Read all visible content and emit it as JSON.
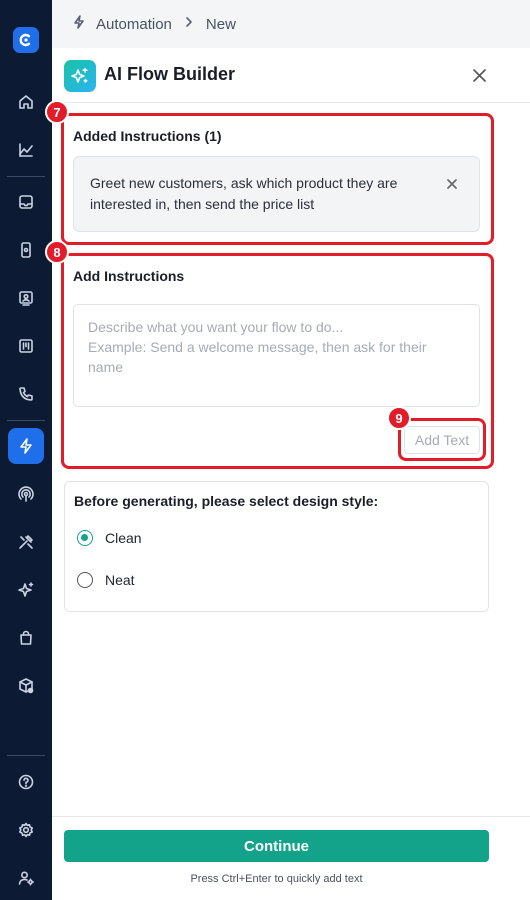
{
  "sidebar": {
    "logo_icon": "brand-logo-icon",
    "items": [
      {
        "icon": "home-icon",
        "label": "Home"
      },
      {
        "icon": "analytics-icon",
        "label": "Analytics"
      },
      {
        "icon": "inbox-icon",
        "label": "Inbox"
      },
      {
        "icon": "mobile-icon",
        "label": "Devices"
      },
      {
        "icon": "contacts-icon",
        "label": "Contacts"
      },
      {
        "icon": "board-icon",
        "label": "Board"
      },
      {
        "icon": "phone-icon",
        "label": "Calls"
      },
      {
        "icon": "automation-icon",
        "label": "Automation",
        "active": true
      },
      {
        "icon": "broadcast-icon",
        "label": "Broadcast"
      },
      {
        "icon": "tools-icon",
        "label": "Tools"
      },
      {
        "icon": "ai-sparkles-icon",
        "label": "AI"
      },
      {
        "icon": "shop-icon",
        "label": "Shop"
      },
      {
        "icon": "package-icon",
        "label": "Packages"
      },
      {
        "icon": "help-icon",
        "label": "Help"
      },
      {
        "icon": "settings-icon",
        "label": "Settings"
      },
      {
        "icon": "user-settings-icon",
        "label": "Account"
      }
    ],
    "bg_color": "#0c1b33",
    "active_color": "#1f6feb"
  },
  "breadcrumb": {
    "icon": "lightning-icon",
    "items": [
      "Automation",
      "New"
    ],
    "separator_icon": "chevron-right-icon"
  },
  "panel": {
    "title": "AI Flow Builder",
    "logo_icon": "sparkles-icon",
    "close_icon": "close-icon",
    "added_instructions": {
      "title": "Added Instructions (1)",
      "items": [
        "Greet new customers, ask which product they are interested in, then send the price list"
      ]
    },
    "add_instructions": {
      "title": "Add Instructions",
      "value": "",
      "placeholder": "Describe what you want your flow to do...\nExample: Send a welcome message, then ask for their name",
      "add_button": "Add Text"
    },
    "design_style": {
      "title": "Before generating, please select design style:",
      "options": [
        {
          "label": "Clean",
          "selected": true
        },
        {
          "label": "Neat",
          "selected": false
        }
      ]
    },
    "continue_button": "Continue",
    "hint": "Press Ctrl+Enter to quickly add text",
    "accent_color": "#12a38a"
  },
  "annotations": [
    {
      "number": "7",
      "target": "added-instructions-section"
    },
    {
      "number": "8",
      "target": "add-instructions-section"
    },
    {
      "number": "9",
      "target": "add-text-button"
    }
  ],
  "annotation_color": "#e11d2a"
}
